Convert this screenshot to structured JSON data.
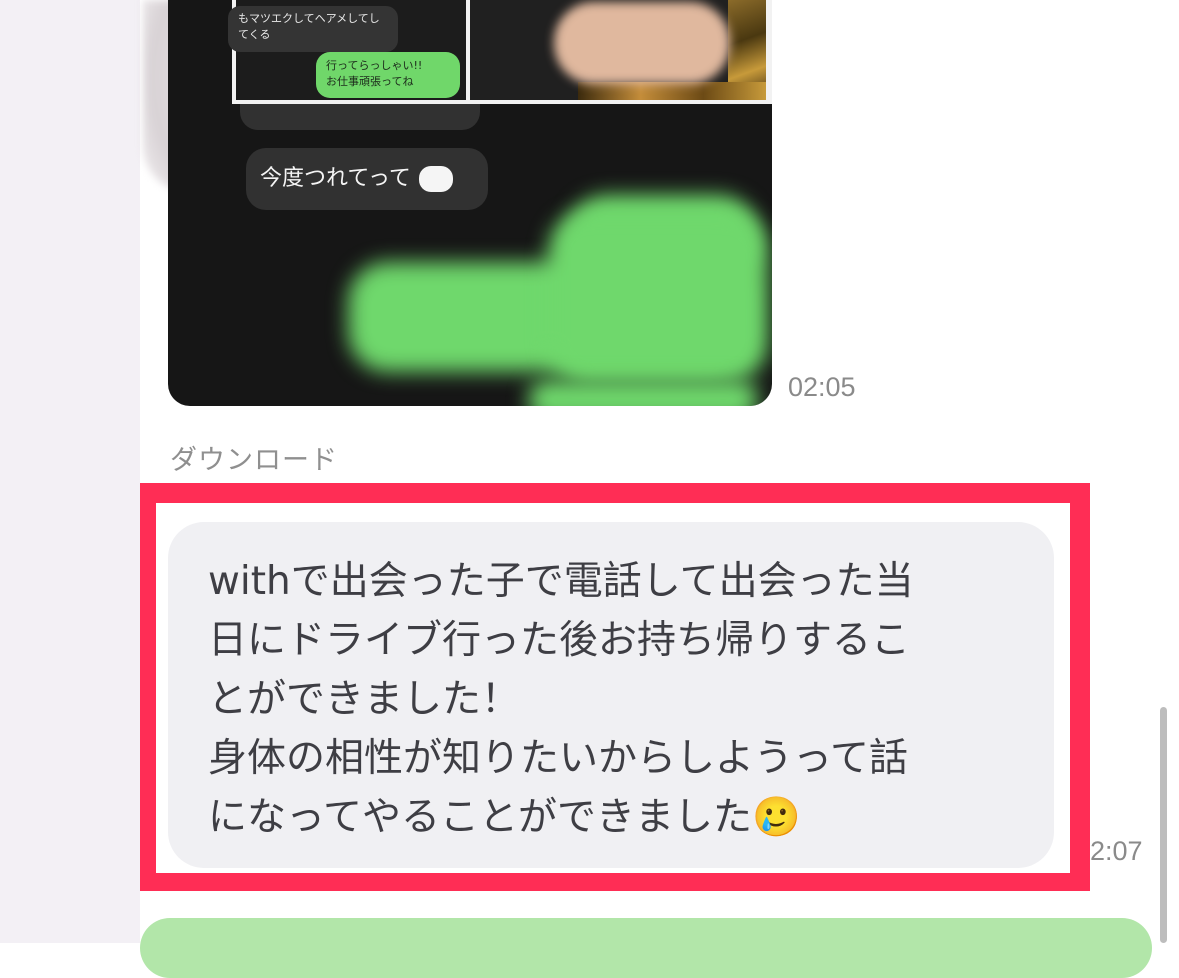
{
  "chat": {
    "image_message": {
      "embedded_screenshot": {
        "top_left_bubble_lines": [
          "もマツエクしてヘアメしてし",
          "てくる"
        ],
        "top_left_reply_lines": [
          "行ってらっしゃい!!",
          "お仕事頑張ってね"
        ],
        "bottom_bubble_partial": "今度つれてって"
      },
      "time": "02:05"
    },
    "download_label": "ダウンロード",
    "highlighted_message": {
      "text": "withで出会った子で電話して出会った当\n日にドライブ行った後お持ち帰りするこ\nとができました！\n身体の相性が知りたいからしようって話\nになってやることができました🥲",
      "time": "2:07"
    },
    "colors": {
      "highlight_border": "#ff2d55",
      "incoming_bubble": "#f0f0f3",
      "outgoing_bubble": "#b2e6a9",
      "text": "#3e3e44",
      "meta_text": "#8a8a8a"
    }
  }
}
